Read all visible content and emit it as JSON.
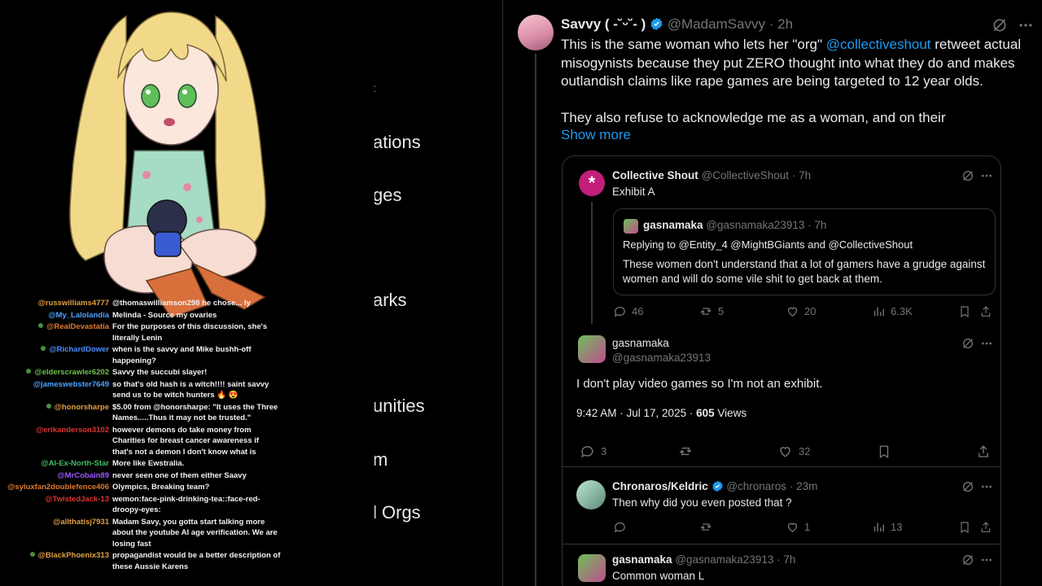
{
  "colors": {
    "accent": "#1d9bf0",
    "muted": "#71767b",
    "border": "#2f3336",
    "like": "#f91880"
  },
  "chat": [
    {
      "user": "@russwilliams4777",
      "color": "#e0a043",
      "message": "@thomaswilliamson298 he chose... ly"
    },
    {
      "user": "@My_Lalolandia",
      "color": "#4da3ff",
      "message": "Melinda - Source my ovaries"
    },
    {
      "user": "@RealDevastatia",
      "color": "#e07a2e",
      "message": "For the purposes of this discussion, she's literally Lenin",
      "badge": true
    },
    {
      "user": "@RichardDower",
      "color": "#4d8eff",
      "message": "when is the savvy and Mike bushh-off happening?",
      "badge": true
    },
    {
      "user": "@elderscrawler6202",
      "color": "#6cc24a",
      "message": "Savvy the succubi slayer!",
      "badge": true
    },
    {
      "user": "@jameswebster7649",
      "color": "#4da3ff",
      "message": "so that's old hash is a witch!!!! saint savvy send us to be witch hunters 🔥 😍"
    },
    {
      "user": "@honorsharpe",
      "color": "#e0a043",
      "message": "$5.00 from @honorsharpe: \"It uses the Three Names.....Thus it may not be trusted.\"",
      "badge": true
    },
    {
      "user": "@erikanderson3102",
      "color": "#e0342e",
      "message": "however demons do take money from Charities for breast cancer awareness if that's not a demon I don't know what is"
    },
    {
      "user": "@Al-Ex-North-Star",
      "color": "#3fbf6a",
      "message": "More like Ewstralia."
    },
    {
      "user": "@MrCobain89",
      "color": "#9b59ff",
      "message": "never seen one of them either Saavy"
    },
    {
      "user": "@syluxfan2doublefence406",
      "color": "#e07a2e",
      "message": "Olympics, Breaking team?"
    },
    {
      "user": "@TwistedJack-13",
      "color": "#e0342e",
      "message": "wemon:face-pink-drinking-tea::face-red-droopy-eyes:"
    },
    {
      "user": "@allthatisj7931",
      "color": "#e0a043",
      "message": "Madam Savy, you gotta start talking more about the youtube AI age verification. We are losing fast"
    },
    {
      "user": "@BlackPhoenix313",
      "color": "#e0a043",
      "message": "propagandist would be a better description of these Aussie Karens",
      "badge": true
    }
  ],
  "nav_fragments": [
    "ations",
    "ges",
    "arks",
    "unities",
    "m",
    "l Orgs"
  ],
  "main_tweet": {
    "display_name": "Savvy ( -˘ᵕ˘- )",
    "handle": "@MadamSavvy",
    "time": "2h",
    "text_before_mention": "This is the same woman who lets her \"org\" ",
    "mention": "@collectiveshout",
    "text_after_mention": " retweet actual misogynists because they put ZERO thought into what they do and makes outlandish claims like rape games are being targeted to 12 year olds.",
    "text_para2": "They also refuse to acknowledge me as a woman, and on their",
    "show_more": "Show more"
  },
  "quote_tweet": {
    "display_name": "Collective Shout",
    "handle": "@CollectiveShout",
    "time": "7h",
    "text": "Exhibit A",
    "inner": {
      "display_name": "gasnamaka",
      "handle": "@gasnamaka23913",
      "time": "7h",
      "replying_to": "Replying to @Entity_4 @MightBGiants and @CollectiveShout",
      "text": "These women don't understand that a lot of gamers have a grudge against women and will do some vile shit to get back at them."
    },
    "stats": {
      "replies": "46",
      "retweets": "5",
      "likes": "20",
      "views": "6.3K"
    }
  },
  "focused_reply": {
    "display_name": "gasnamaka",
    "handle": "@gasnamaka23913",
    "text": "I don't play video games so I'm not an exhibit.",
    "timestamp": "9:42 AM · Jul 17, 2025 · ",
    "views_count": "605",
    "views_label": " Views",
    "stats": {
      "replies": "3",
      "retweets": "",
      "likes": "32"
    }
  },
  "reply1": {
    "display_name": "Chronaros/Keldric",
    "handle": "@chronaros",
    "time": "23m",
    "text": "Then why did you even posted that ?",
    "stats": {
      "replies": "",
      "retweets": "",
      "likes": "1",
      "views": "13"
    }
  },
  "reply2": {
    "display_name": "gasnamaka",
    "handle": "@gasnamaka23913",
    "time": "7h",
    "text": "Common woman L"
  }
}
